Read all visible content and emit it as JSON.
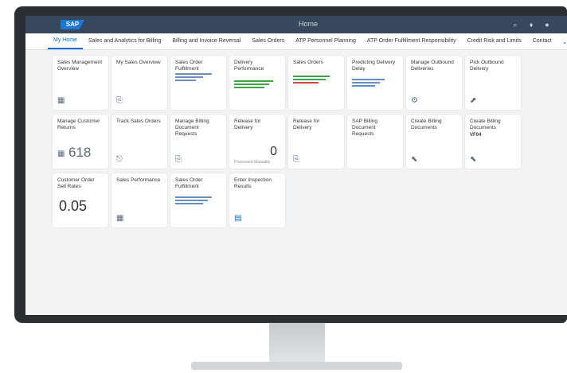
{
  "shell": {
    "logo": "SAP",
    "home_title": "Home"
  },
  "tabs": [
    {
      "label": "My Home",
      "active": true
    },
    {
      "label": "Sales and Analytics for Billing"
    },
    {
      "label": "Billing and Invoice Reversal"
    },
    {
      "label": "Sales Orders"
    },
    {
      "label": "ATP Personnel Planning"
    },
    {
      "label": "ATP Order Fulfillment Responsibility"
    },
    {
      "label": "Credit Risk and Limits"
    },
    {
      "label": "Contact"
    }
  ],
  "tiles": [
    {
      "id": "t1",
      "title": "Sales Management Overview",
      "sub": "",
      "icon": "▦"
    },
    {
      "id": "t2",
      "title": "My Sales Overview",
      "sub": "",
      "icon": "⎘"
    },
    {
      "id": "t3",
      "title": "Sales Order Fulfillment",
      "sub": "",
      "mini": [
        [
          "",
          ""
        ],
        [
          "",
          ""
        ],
        [
          "",
          ""
        ]
      ],
      "foot": ""
    },
    {
      "id": "t4",
      "title": "Delivery Performance",
      "sub": "",
      "mini": [
        [
          "",
          ""
        ],
        [
          "",
          ""
        ],
        [
          "",
          ""
        ]
      ],
      "foot": ""
    },
    {
      "id": "t5",
      "title": "Sales Orders",
      "sub": "",
      "mini": [
        [
          "",
          ""
        ],
        [
          "",
          ""
        ],
        [
          "",
          ""
        ]
      ],
      "foot": ""
    },
    {
      "id": "t6",
      "title": "Predicting Delivery Delay",
      "sub": "",
      "mini": [
        [
          "",
          ""
        ],
        [
          "",
          ""
        ],
        [
          "",
          ""
        ]
      ],
      "foot": ""
    },
    {
      "id": "t7",
      "title": "Manage Outbound Deliveries",
      "sub": "",
      "icon": "⚙"
    },
    {
      "id": "t8",
      "title": "Pick Outbound Delivery",
      "sub": "",
      "icon": "⬈"
    },
    {
      "id": "t9",
      "title": "Manage Customer Returns",
      "value": "618",
      "icon": "▦"
    },
    {
      "id": "t10",
      "title": "Track Sales Orders",
      "icon": "⎋"
    },
    {
      "id": "t11",
      "title": "Manage Billing Document Requests",
      "icon": "⎘"
    },
    {
      "id": "t12",
      "title": "Release for Delivery",
      "value": "0",
      "foot": "Processed Manually"
    },
    {
      "id": "t13",
      "title": "Release for Delivery",
      "icon": "⎘"
    },
    {
      "id": "t14",
      "title": "SAP Billing Document Requests",
      "icon": ""
    },
    {
      "id": "t15",
      "title": "Create Billing Documents",
      "sub": "",
      "icon": "⬉"
    },
    {
      "id": "t16",
      "title": "Create Billing Documents",
      "tag": "VF04",
      "icon": "⬉"
    },
    {
      "id": "t17",
      "title": "Customer Order Sell Rates",
      "sub": "",
      "value": "0.05"
    },
    {
      "id": "t18",
      "title": "Sales Performance",
      "sub": "",
      "icon": "▦"
    },
    {
      "id": "t19",
      "title": "Sales Order Fulfillment",
      "sub": "",
      "mini": [
        [
          "",
          ""
        ],
        [
          "",
          ""
        ],
        [
          "",
          ""
        ]
      ]
    },
    {
      "id": "t20",
      "title": "Enter Inspection Results",
      "sub": "",
      "icon": "▤"
    }
  ]
}
